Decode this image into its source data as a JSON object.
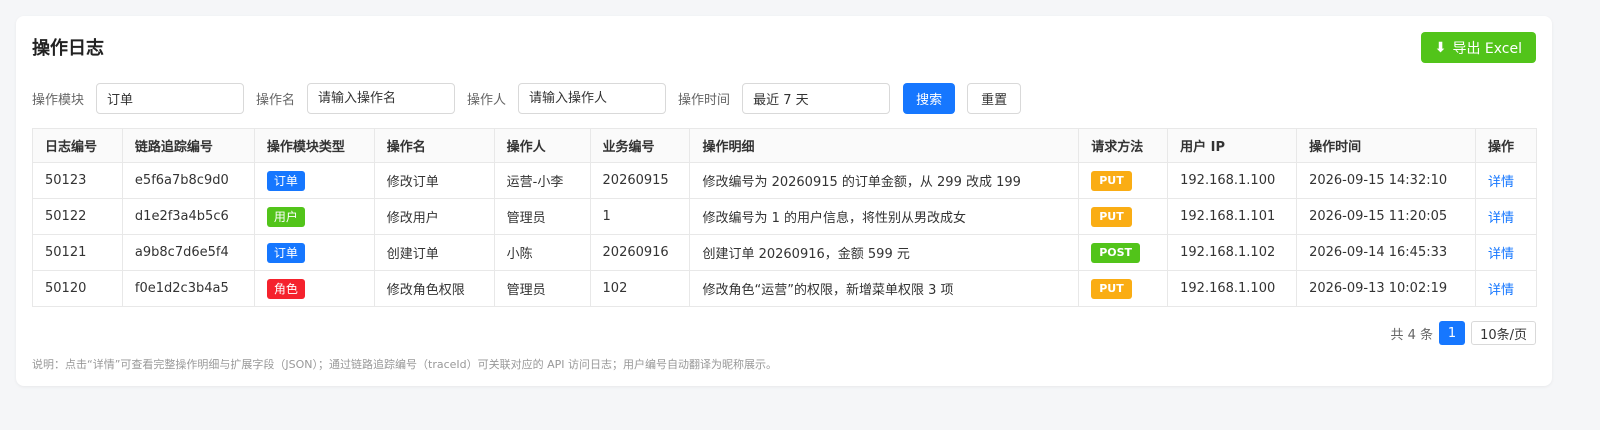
{
  "header": {
    "title": "操作日志",
    "export_label": "导出 Excel"
  },
  "filters": {
    "module_label": "操作模块",
    "module_value": "订单",
    "name_label": "操作名",
    "name_placeholder": "请输入操作名",
    "operator_label": "操作人",
    "operator_placeholder": "请输入操作人",
    "time_label": "操作时间",
    "time_value": "最近 7 天",
    "search_label": "搜索",
    "reset_label": "重置"
  },
  "table": {
    "columns": [
      "日志编号",
      "链路追踪编号",
      "操作模块类型",
      "操作名",
      "操作人",
      "业务编号",
      "操作明细",
      "请求方法",
      "用户 IP",
      "操作时间",
      "操作"
    ],
    "rows": [
      {
        "id": "50123",
        "trace": "e5f6a7b8c9d0",
        "module": "订单",
        "module_color": "#1677ff",
        "name": "修改订单",
        "operator": "运营-小李",
        "biz": "20260915",
        "detail": "修改编号为 20260915 的订单金额，从 299 改成 199",
        "method": "PUT",
        "method_color": "#faad14",
        "ip": "192.168.1.100",
        "time": "2026-09-15 14:32:10",
        "action": "详情"
      },
      {
        "id": "50122",
        "trace": "d1e2f3a4b5c6",
        "module": "用户",
        "module_color": "#52c41a",
        "name": "修改用户",
        "operator": "管理员",
        "biz": "1",
        "detail": "修改编号为 1 的用户信息，将性别从男改成女",
        "method": "PUT",
        "method_color": "#faad14",
        "ip": "192.168.1.101",
        "time": "2026-09-15 11:20:05",
        "action": "详情"
      },
      {
        "id": "50121",
        "trace": "a9b8c7d6e5f4",
        "module": "订单",
        "module_color": "#1677ff",
        "name": "创建订单",
        "operator": "小陈",
        "biz": "20260916",
        "detail": "创建订单 20260916，金额 599 元",
        "method": "POST",
        "method_color": "#52c41a",
        "ip": "192.168.1.102",
        "time": "2026-09-14 16:45:33",
        "action": "详情"
      },
      {
        "id": "50120",
        "trace": "f0e1d2c3b4a5",
        "module": "角色",
        "module_color": "#f5222d",
        "name": "修改角色权限",
        "operator": "管理员",
        "biz": "102",
        "detail": "修改角色“运营”的权限，新增菜单权限 3 项",
        "method": "PUT",
        "method_color": "#faad14",
        "ip": "192.168.1.100",
        "time": "2026-09-13 10:02:19",
        "action": "详情"
      }
    ]
  },
  "pagination": {
    "total_text": "共 4 条",
    "current_page": "1",
    "page_size": "10条/页"
  },
  "note": "说明：点击“详情”可查看完整操作明细与扩展字段（JSON）；通过链路追踪编号（traceId）可关联对应的 API 访问日志；用户编号自动翻译为昵称展示。",
  "icons": {
    "export": "download-icon"
  },
  "colors": {
    "primary": "#1677ff",
    "success": "#52c41a",
    "warning": "#faad14",
    "danger": "#f5222d"
  }
}
